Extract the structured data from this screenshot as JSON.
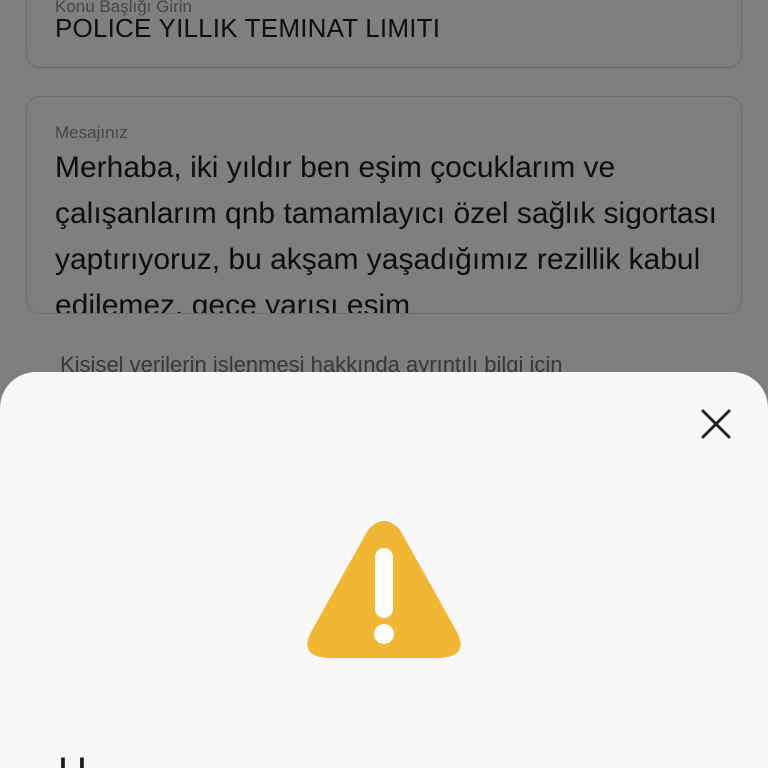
{
  "form": {
    "subject": {
      "label": "Konu Başlığı Girin",
      "value": "POLICE YILLIK TEMINAT LIMITI"
    },
    "message": {
      "label": "Mesajınız",
      "value": "Merhaba, iki yıldır ben eşim çocuklarım ve çalışanlarım qnb tamamlayıcı özel sağlık sigortası yaptırıyoruz, bu akşam yaşadığımız rezillik kabul edilemez, gece yarısı eşim"
    },
    "privacy_text": "Kişisel verilerin işlenmesi hakkında ayrıntılı bilgi için"
  },
  "sheet": {
    "close_icon": "close-icon",
    "warning_icon": "warning-triangle-icon",
    "warning_color": "#F0B634",
    "title": "U"
  }
}
